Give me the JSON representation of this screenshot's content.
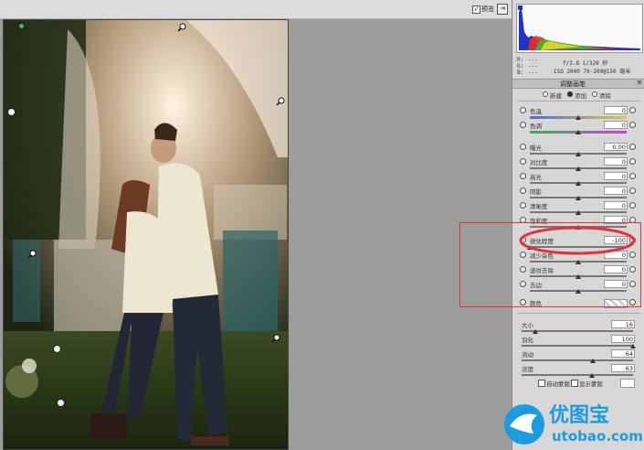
{
  "topbar": {
    "checkbox_label": "预览",
    "checked": true
  },
  "histogram": {
    "r_label": "R:",
    "g_label": "G:",
    "b_label": "B:",
    "r_value": "---",
    "g_value": "---",
    "b_value": "---",
    "exif_line1": "f/2.8   1/320 秒",
    "exif_line2": "ISO 2000   70-200@150 毫米"
  },
  "panel": {
    "title": "调整画笔",
    "modes": [
      "新建",
      "添加",
      "清除"
    ],
    "selected_mode": "添加",
    "sliders": [
      {
        "label": "色温",
        "value": "0"
      },
      {
        "label": "色调",
        "value": "0"
      },
      {
        "label": "曝光",
        "value": "0.00"
      },
      {
        "label": "对比度",
        "value": "0"
      },
      {
        "label": "高光",
        "value": "0"
      },
      {
        "label": "阴影",
        "value": "0"
      },
      {
        "label": "清晰度",
        "value": "0"
      },
      {
        "label": "饱和度",
        "value": "0"
      },
      {
        "label": "锐化程度",
        "value": "-100"
      },
      {
        "label": "减少杂色",
        "value": "0"
      },
      {
        "label": "波纹去除",
        "value": "0"
      },
      {
        "label": "去边",
        "value": "0"
      }
    ],
    "color_label": "颜色",
    "brush": [
      {
        "label": "大小",
        "value": "16"
      },
      {
        "label": "羽化",
        "value": "100"
      },
      {
        "label": "流动",
        "value": "64"
      },
      {
        "label": "浓度",
        "value": "63"
      }
    ],
    "auto_mask_label": "自动蒙版",
    "show_mask_label": "显示蒙版"
  },
  "watermark": {
    "name": "优图宝",
    "url": "utobao.com"
  },
  "colors": {
    "highlight": "#e0333b",
    "watermark_blue": "#1b9be0"
  }
}
